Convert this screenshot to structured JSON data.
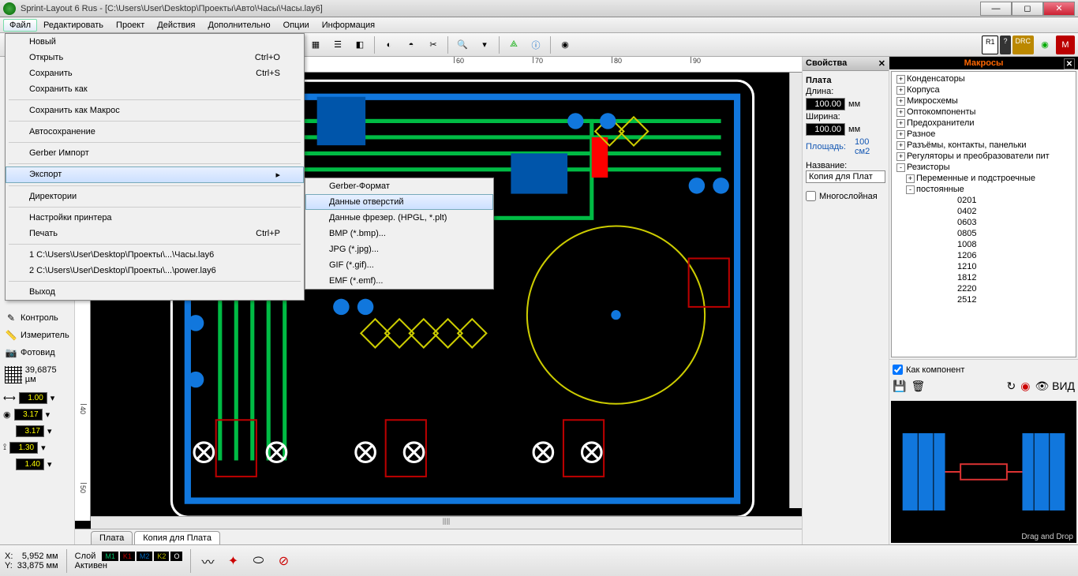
{
  "title": "Sprint-Layout 6 Rus - [C:\\Users\\User\\Desktop\\Проекты\\Авто\\Часы\\Часы.lay6]",
  "menubar": [
    "Файл",
    "Редактировать",
    "Проект",
    "Действия",
    "Дополнительно",
    "Опции",
    "Информация"
  ],
  "file_menu": {
    "items": [
      {
        "label": "Новый",
        "shortcut": "",
        "sep": false
      },
      {
        "label": "Открыть",
        "shortcut": "Ctrl+O",
        "sep": false
      },
      {
        "label": "Сохранить",
        "shortcut": "Ctrl+S",
        "sep": false
      },
      {
        "label": "Сохранить как",
        "shortcut": "",
        "sep": true
      },
      {
        "label": "Сохранить как Макрос",
        "shortcut": "",
        "sep": true
      },
      {
        "label": "Автосохранение",
        "shortcut": "",
        "sep": true
      },
      {
        "label": "Gerber Импорт",
        "shortcut": "",
        "sep": true
      },
      {
        "label": "Экспорт",
        "shortcut": "",
        "arrow": true,
        "highlighted": true,
        "sep": true
      },
      {
        "label": "Директории",
        "shortcut": "",
        "sep": true
      },
      {
        "label": "Настройки принтера",
        "shortcut": "",
        "sep": false
      },
      {
        "label": "Печать",
        "shortcut": "Ctrl+P",
        "sep": true
      },
      {
        "label": "1 C:\\Users\\User\\Desktop\\Проекты\\...\\Часы.lay6",
        "shortcut": "",
        "sep": false
      },
      {
        "label": "2 C:\\Users\\User\\Desktop\\Проекты\\...\\power.lay6",
        "shortcut": "",
        "sep": true
      },
      {
        "label": "Выход",
        "shortcut": "",
        "sep": false
      }
    ]
  },
  "export_submenu": [
    {
      "label": "Gerber-Формат",
      "sep": false
    },
    {
      "label": "Данные отверстий",
      "highlighted": true,
      "sep": false
    },
    {
      "label": "Данные фрезер. (HPGL, *.plt)",
      "sep": true
    },
    {
      "label": "BMP (*.bmp)...",
      "sep": false
    },
    {
      "label": "JPG (*.jpg)...",
      "sep": false
    },
    {
      "label": "GIF (*.gif)...",
      "sep": false
    },
    {
      "label": "EMF (*.emf)...",
      "sep": false
    }
  ],
  "ruler_h": [
    "60",
    "70",
    "80",
    "90"
  ],
  "ruler_v": [
    "40",
    "50"
  ],
  "left_tools": {
    "control": "Контроль",
    "measure": "Измеритель",
    "photo": "Фотовид",
    "grid_value": "39,6875 µм",
    "vals": [
      "1.00",
      "3.17",
      "3.17",
      "1.30",
      "1.40"
    ]
  },
  "tabs": [
    "Плата",
    "Копия для Плата"
  ],
  "properties": {
    "header": "Свойства",
    "board": "Плата",
    "length_label": "Длина:",
    "length_val": "100.00",
    "width_label": "Ширина:",
    "width_val": "100.00",
    "unit": "мм",
    "area_label": "Площадь:",
    "area_val": "100 см2",
    "name_label": "Название:",
    "name_val": "Копия для Плат",
    "multilayer": "Многослойная"
  },
  "macros": {
    "header": "Макросы",
    "tree": [
      {
        "label": "Конденсаторы",
        "lvl": 0,
        "exp": "+"
      },
      {
        "label": "Корпуса",
        "lvl": 0,
        "exp": "+"
      },
      {
        "label": "Микросхемы",
        "lvl": 0,
        "exp": "+"
      },
      {
        "label": "Оптокомпоненты",
        "lvl": 0,
        "exp": "+"
      },
      {
        "label": "Предохранители",
        "lvl": 0,
        "exp": "+"
      },
      {
        "label": "Разное",
        "lvl": 0,
        "exp": "+"
      },
      {
        "label": "Разъёмы, контакты, панельки",
        "lvl": 0,
        "exp": "+"
      },
      {
        "label": "Регуляторы и преобразователи пит",
        "lvl": 0,
        "exp": "+"
      },
      {
        "label": "Резисторы",
        "lvl": 0,
        "exp": "-"
      },
      {
        "label": "Переменные и подстроечные",
        "lvl": 1,
        "exp": "+"
      },
      {
        "label": "постоянные",
        "lvl": 1,
        "exp": "-"
      },
      {
        "label": "0201",
        "lvl": 2
      },
      {
        "label": "0402",
        "lvl": 2
      },
      {
        "label": "0603",
        "lvl": 2
      },
      {
        "label": "0805",
        "lvl": 2
      },
      {
        "label": "1008",
        "lvl": 2
      },
      {
        "label": "1206",
        "lvl": 2
      },
      {
        "label": "1210",
        "lvl": 2
      },
      {
        "label": "1812",
        "lvl": 2
      },
      {
        "label": "2220",
        "lvl": 2
      },
      {
        "label": "2512",
        "lvl": 2
      }
    ],
    "as_component": "Как компонент",
    "drag_label": "Drag and Drop"
  },
  "status": {
    "x_label": "X:",
    "x_val": "5,952 мм",
    "y_label": "Y:",
    "y_val": "33,875 мм",
    "layer_label": "Слой",
    "active_label": "Активен",
    "layers": [
      {
        "name": "M1",
        "color": "#0b6"
      },
      {
        "name": "K1",
        "color": "#b00"
      },
      {
        "name": "M2",
        "color": "#06b"
      },
      {
        "name": "K2",
        "color": "#bb0"
      },
      {
        "name": "O",
        "color": "#fff"
      }
    ]
  },
  "toolbar_right": [
    "R1",
    "?",
    "DRC"
  ]
}
